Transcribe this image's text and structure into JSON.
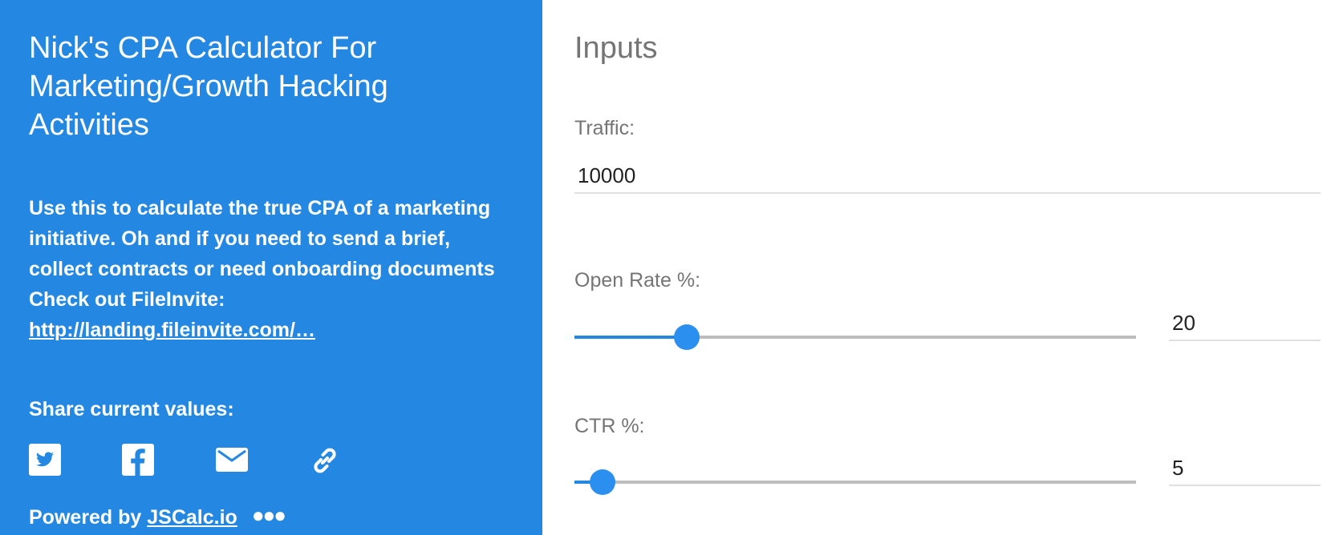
{
  "sidebar": {
    "title": "Nick's CPA Calculator For Marketing/Growth Hacking Activities",
    "description": "Use this to calculate the true CPA of a marketing initiative. Oh and if you need to send a brief, collect contracts or need onboarding documents Check out FileInvite:",
    "link_text": "http://landing.fileinvite.com/…",
    "share_label": "Share current values:",
    "share_icons": [
      "twitter-icon",
      "facebook-icon",
      "email-icon",
      "link-icon"
    ],
    "powered_prefix": "Powered by ",
    "powered_link": "JSCalc.io",
    "more_icon": "more-dots-icon",
    "background_color": "#2488e3"
  },
  "main": {
    "section_title": "Inputs",
    "fields": {
      "traffic": {
        "label": "Traffic:",
        "value": "10000"
      },
      "open_rate": {
        "label": "Open Rate %:",
        "value": "20",
        "slider_level": 0.2
      },
      "ctr": {
        "label": "CTR %:",
        "value": "5",
        "slider_level": 0.05
      }
    },
    "accent_color": "#2b8ff0"
  }
}
